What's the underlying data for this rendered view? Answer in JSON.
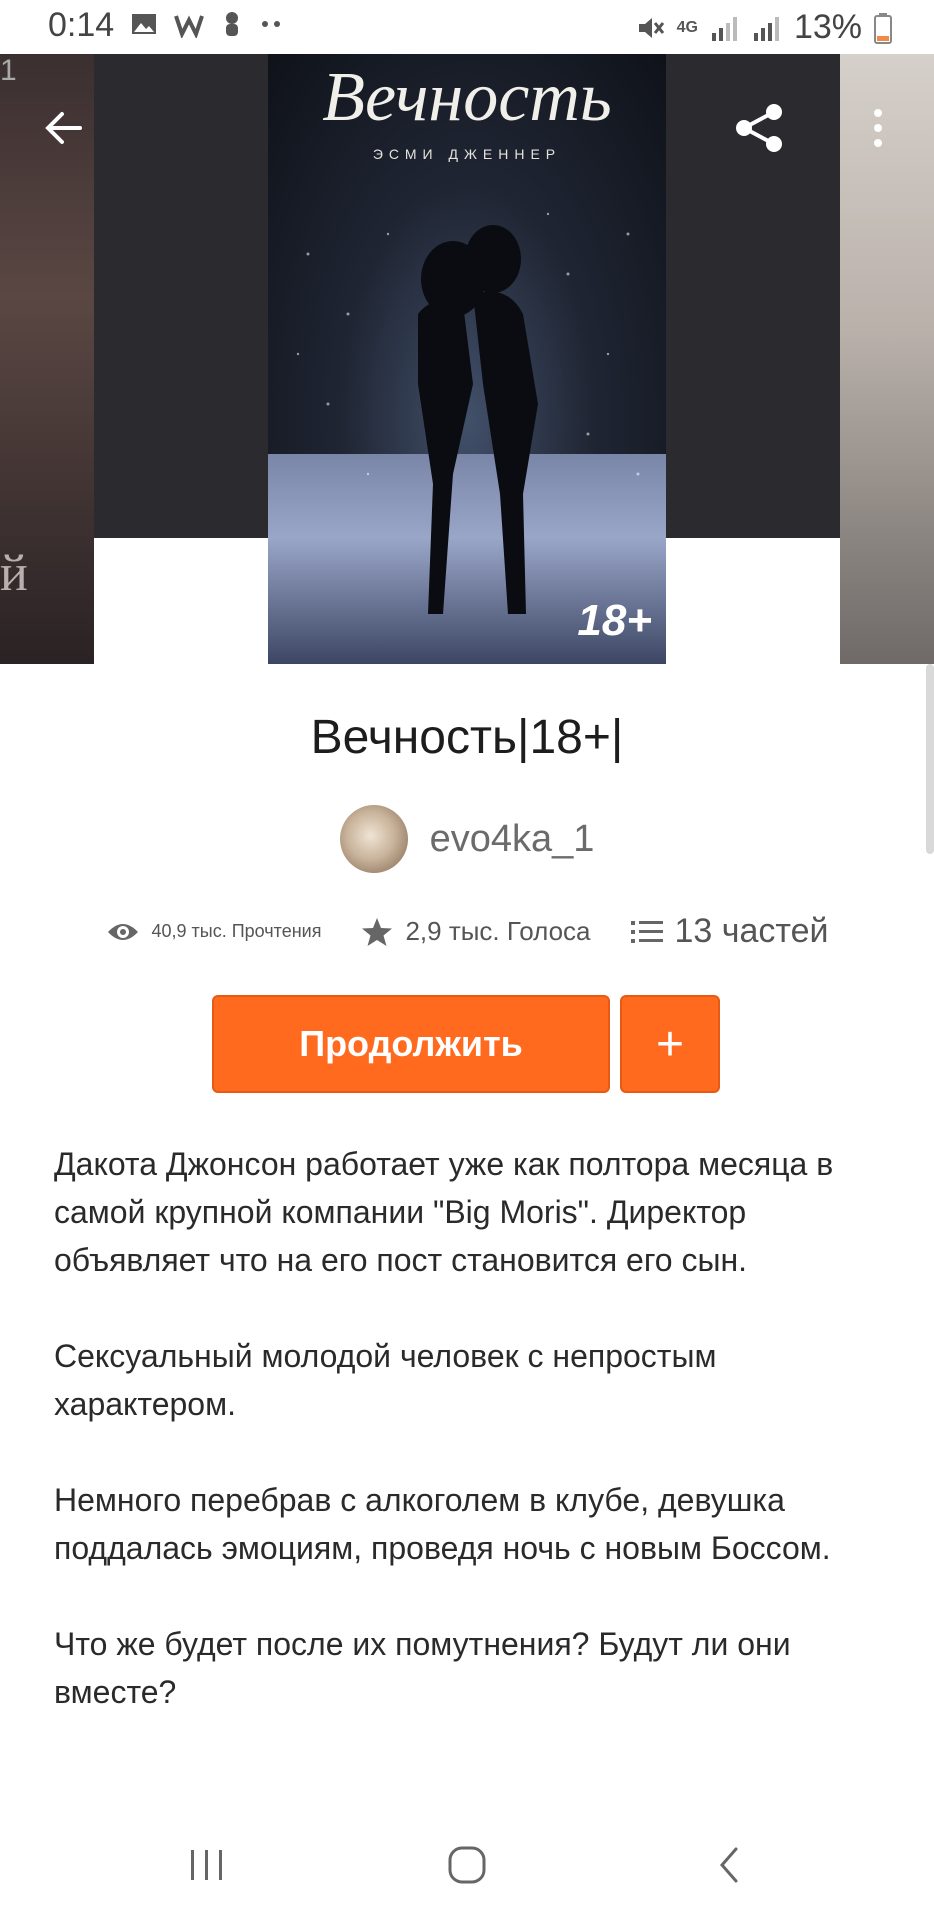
{
  "status_bar": {
    "time": "0:14",
    "battery": "13%",
    "network": "4G"
  },
  "hero": {
    "cover_title": "Вечность",
    "cover_author": "ЭСМИ ДЖЕННЕР",
    "cover_badge": "18+",
    "left_edge_letter": "й",
    "left_top_text": "1"
  },
  "book": {
    "title": "Вечность|18+|",
    "author": "evo4ka_1",
    "reads": "40,9 тыс. Прочтения",
    "votes": "2,9 тыс. Голоса",
    "parts": "13 частей"
  },
  "actions": {
    "continue_label": "Продолжить",
    "add_label": "+"
  },
  "description": {
    "p1": "Дакота Джонсон работает уже как полтора месяца в самой крупной компании \"Big Moris\". Директор объявляет что на его пост становится его сын.",
    "p2": "Сексуальный молодой человек с непростым характером.",
    "p3": "Немного перебрав с алкоголем в клубе, девушка поддалась эмоциям, проведя ночь с новым Боссом.",
    "p4": "Что же будет после их помутнения? Будут ли они вместе?"
  },
  "colors": {
    "accent": "#ff6a1f",
    "hero_dark": "#2b2b2f"
  },
  "icons": {
    "back": "arrow-left-icon",
    "share": "share-icon",
    "more": "more-vertical-icon",
    "reads": "eye-icon",
    "votes": "star-icon",
    "parts": "list-icon"
  }
}
